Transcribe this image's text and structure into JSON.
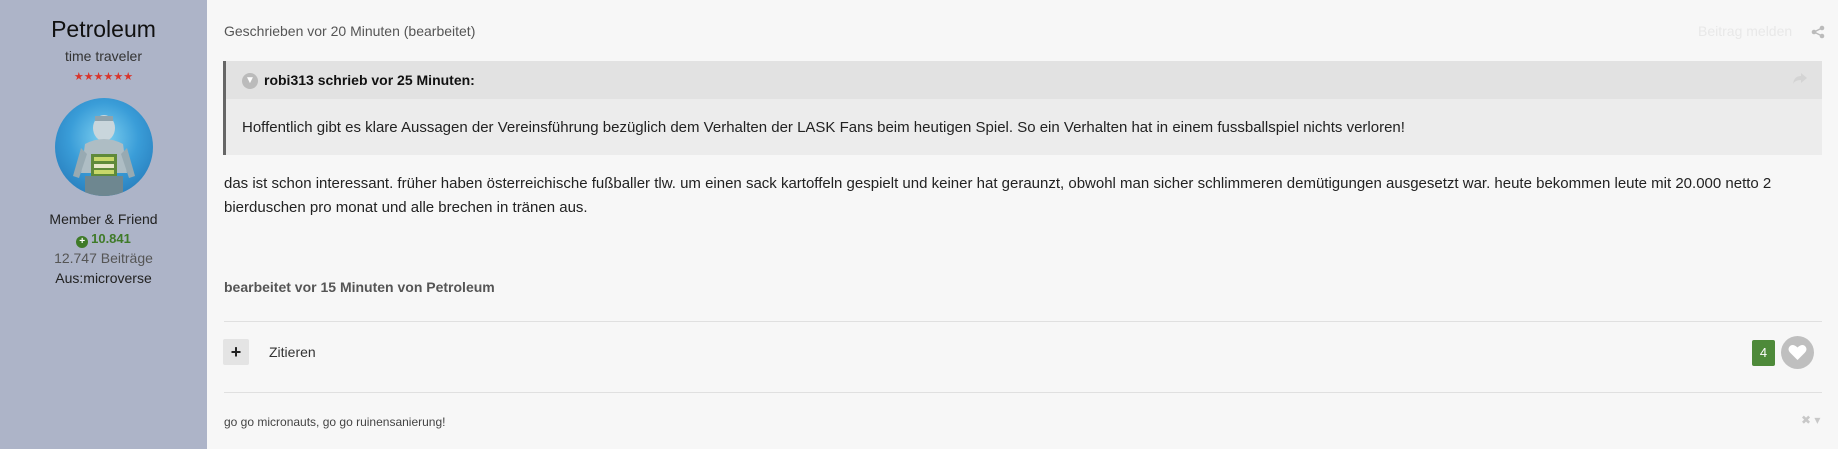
{
  "author": {
    "name": "Petroleum",
    "title": "time traveler",
    "stars": "★★★★★★",
    "group": "Member & Friend",
    "reputation": "10.841",
    "posts": "12.747 Beiträge",
    "location": "Aus:microverse"
  },
  "post": {
    "meta": "Geschrieben vor 20 Minuten (bearbeitet)",
    "report_label": "Beitrag melden",
    "quote": {
      "citation": "robi313 schrieb vor 25 Minuten:",
      "text": "Hoffentlich gibt es klare Aussagen der Vereinsführung bezüglich dem Verhalten der LASK Fans beim heutigen Spiel. So ein Verhalten hat in einem fussballspiel nichts verloren!"
    },
    "body": "das ist schon interessant. früher haben österreichische fußballer tlw. um einen sack kartoffeln gespielt und keiner hat geraunzt, obwohl man sicher schlimmeren demütigungen ausgesetzt war. heute bekommen leute mit 20.000 netto 2 bierduschen pro monat und alle brechen in tränen aus.",
    "edited": "bearbeitet vor 15 Minuten von Petroleum",
    "actions": {
      "plus_label": "+",
      "quote_label": "Zitieren",
      "like_count": "4"
    },
    "signature": "go go micronauts, go go ruinensanierung!",
    "signature_hide": "✖ ▾"
  },
  "colors": {
    "sidebar_bg": "#adb4c8",
    "like_count_bg": "#4e8a3a",
    "reputation": "#3f7a28",
    "stars": "#d9342b"
  },
  "icons": {
    "share": "share-icon",
    "quote_toggle": "chevron-down-icon",
    "quote_share": "reply-arrow-icon",
    "like": "heart-icon",
    "reputation": "plus-circle-icon"
  }
}
